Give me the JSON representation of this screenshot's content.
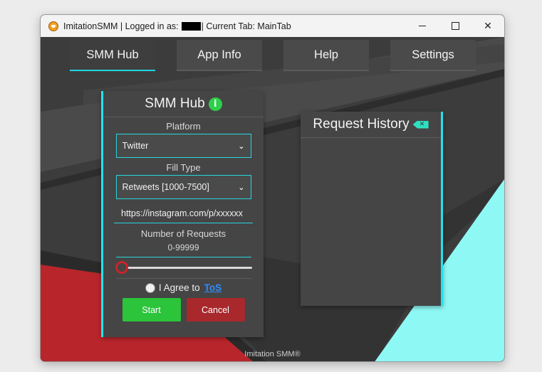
{
  "window": {
    "title_prefix": "ImitationSMM | Logged in as: ",
    "title_suffix": "| Current Tab: MainTab",
    "minimize_icon": "minimize-icon",
    "maximize_icon": "maximize-icon",
    "close_symbol": "✕"
  },
  "nav": {
    "tabs": [
      {
        "label": "SMM Hub",
        "active": true
      },
      {
        "label": "App Info",
        "active": false
      },
      {
        "label": "Help",
        "active": false
      },
      {
        "label": "Settings",
        "active": false
      }
    ]
  },
  "smm_hub": {
    "title": "SMM Hub",
    "info_symbol": "i",
    "platform_label": "Platform",
    "platform_value": "Twitter",
    "fill_type_label": "Fill Type",
    "fill_type_value": "Retweets [1000-7500]",
    "url_value": "https://instagram.com/p/xxxxxx",
    "requests_label": "Number of Requests",
    "requests_range": "0-99999",
    "slider_value": 0,
    "agree_text": "I Agree to",
    "tos_link": "ToS",
    "start_label": "Start",
    "cancel_label": "Cancel"
  },
  "history": {
    "title": "Request History",
    "clear_symbol": "✕"
  },
  "footer": "Imitation SMM®",
  "colors": {
    "accent": "#22e3ee",
    "start": "#2bc43b",
    "cancel": "#a8282c",
    "bg_red": "#b8262b",
    "bg_cyan": "#8ef8f5"
  }
}
